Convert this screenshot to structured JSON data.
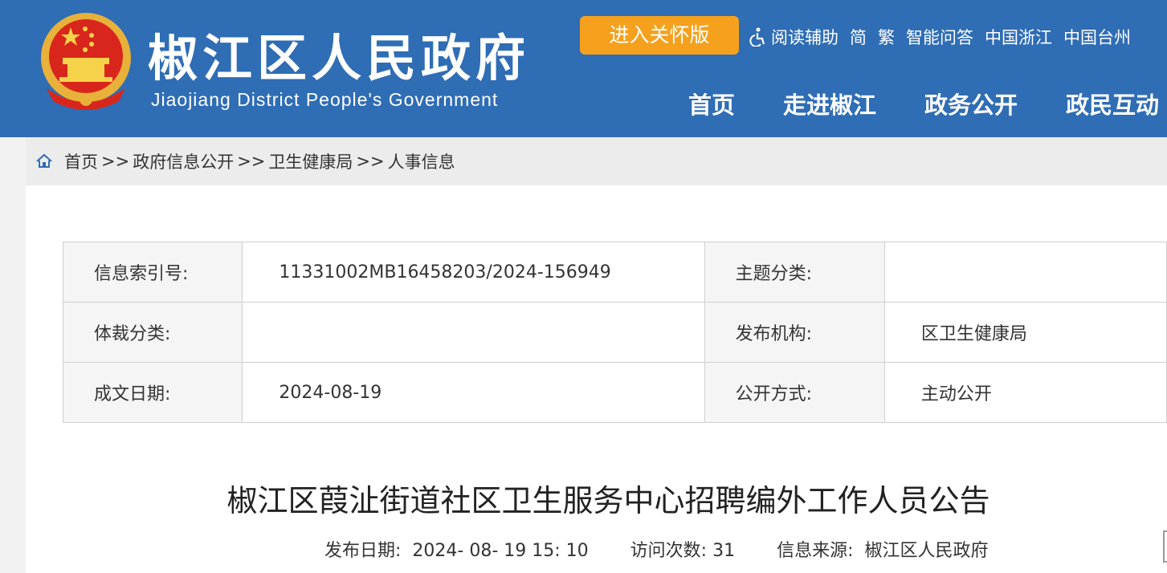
{
  "header": {
    "title": "椒江区人民政府",
    "subtitle": "Jiaojiang District People's Government",
    "care_button": "进入关怀版",
    "top_links": [
      "阅读辅助",
      "简",
      "繁",
      "智能问答",
      "中国浙江",
      "中国台州"
    ],
    "nav": [
      "首页",
      "走进椒江",
      "政务公开",
      "政民互动"
    ],
    "colors": {
      "header_bg": "#2f6db5",
      "care_btn": "#f5a11d"
    }
  },
  "breadcrumb": {
    "icon": "home-icon",
    "items": [
      "首页",
      "政府信息公开",
      "卫生健康局",
      "人事信息"
    ],
    "separator": ">>"
  },
  "meta_table": {
    "rows": [
      {
        "l1": "信息索引号:",
        "v1": "11331002MB16458203/2024-156949",
        "l2": "主题分类:",
        "v2": ""
      },
      {
        "l1": "体裁分类:",
        "v1": "",
        "l2": "发布机构:",
        "v2": "区卫生健康局"
      },
      {
        "l1": "成文日期:",
        "v1": "2024-08-19",
        "l2": "公开方式:",
        "v2": "主动公开"
      }
    ]
  },
  "article": {
    "title": "椒江区葭沚街道社区卫生服务中心招聘编外工作人员公告",
    "publish_label": "发布日期:",
    "publish_value": "2024- 08- 19 15: 10",
    "visits_label": "访问次数:",
    "visits_value": "31",
    "source_label": "信息来源:",
    "source_value": "椒江区人民政府"
  }
}
